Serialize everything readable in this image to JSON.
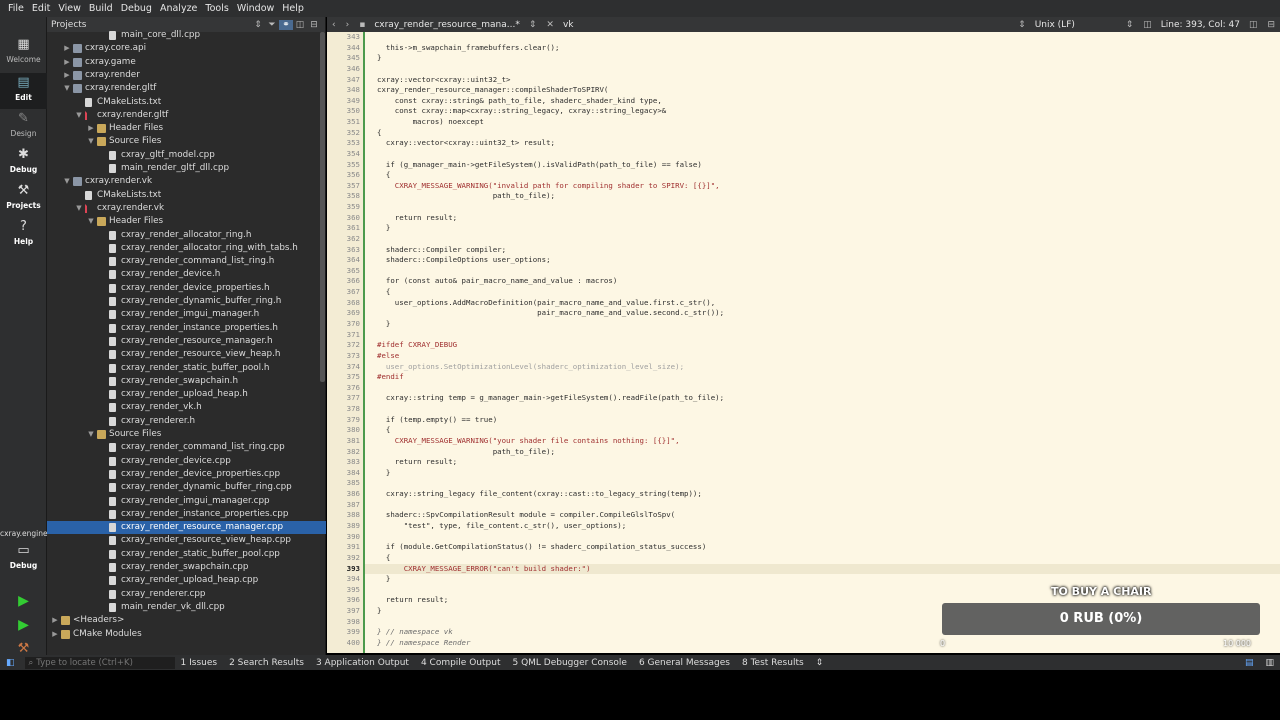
{
  "menu": [
    "File",
    "Edit",
    "View",
    "Build",
    "Debug",
    "Analyze",
    "Tools",
    "Window",
    "Help"
  ],
  "modes": [
    {
      "label": "Welcome",
      "icon": "grid-icon"
    },
    {
      "label": "Edit",
      "icon": "edit-icon"
    },
    {
      "label": "Design",
      "icon": "pen-icon"
    },
    {
      "label": "Debug",
      "icon": "bug-icon"
    },
    {
      "label": "Projects",
      "icon": "wrench-icon"
    },
    {
      "label": "Help",
      "icon": "help-icon"
    }
  ],
  "kit": {
    "name": "cxray.engine",
    "mode": "Debug"
  },
  "projects_panel": {
    "title": "Projects"
  },
  "tree": [
    {
      "label": "main_core_dll.cpp",
      "indent": 5,
      "icon": "file"
    },
    {
      "label": "cxray.core.api",
      "indent": 2,
      "icon": "proj",
      "arrow": "right"
    },
    {
      "label": "cxray.game",
      "indent": 2,
      "icon": "proj",
      "arrow": "right"
    },
    {
      "label": "cxray.render",
      "indent": 2,
      "icon": "proj",
      "arrow": "right"
    },
    {
      "label": "cxray.render.gltf",
      "indent": 2,
      "icon": "proj",
      "arrow": "down"
    },
    {
      "label": "CMakeLists.txt",
      "indent": 3,
      "icon": "file"
    },
    {
      "label": "cxray.render.gltf",
      "indent": 3,
      "icon": "cmake",
      "arrow": "down"
    },
    {
      "label": "Header Files",
      "indent": 4,
      "icon": "folder",
      "arrow": "right"
    },
    {
      "label": "Source Files",
      "indent": 4,
      "icon": "folder",
      "arrow": "down"
    },
    {
      "label": "cxray_gltf_model.cpp",
      "indent": 5,
      "icon": "file"
    },
    {
      "label": "main_render_gltf_dll.cpp",
      "indent": 5,
      "icon": "file"
    },
    {
      "label": "cxray.render.vk",
      "indent": 2,
      "icon": "proj",
      "arrow": "down"
    },
    {
      "label": "CMakeLists.txt",
      "indent": 3,
      "icon": "file"
    },
    {
      "label": "cxray.render.vk",
      "indent": 3,
      "icon": "cmake",
      "arrow": "down"
    },
    {
      "label": "Header Files",
      "indent": 4,
      "icon": "folder",
      "arrow": "down"
    },
    {
      "label": "cxray_render_allocator_ring.h",
      "indent": 5,
      "icon": "file"
    },
    {
      "label": "cxray_render_allocator_ring_with_tabs.h",
      "indent": 5,
      "icon": "file"
    },
    {
      "label": "cxray_render_command_list_ring.h",
      "indent": 5,
      "icon": "file"
    },
    {
      "label": "cxray_render_device.h",
      "indent": 5,
      "icon": "file"
    },
    {
      "label": "cxray_render_device_properties.h",
      "indent": 5,
      "icon": "file"
    },
    {
      "label": "cxray_render_dynamic_buffer_ring.h",
      "indent": 5,
      "icon": "file"
    },
    {
      "label": "cxray_render_imgui_manager.h",
      "indent": 5,
      "icon": "file"
    },
    {
      "label": "cxray_render_instance_properties.h",
      "indent": 5,
      "icon": "file"
    },
    {
      "label": "cxray_render_resource_manager.h",
      "indent": 5,
      "icon": "file"
    },
    {
      "label": "cxray_render_resource_view_heap.h",
      "indent": 5,
      "icon": "file"
    },
    {
      "label": "cxray_render_static_buffer_pool.h",
      "indent": 5,
      "icon": "file"
    },
    {
      "label": "cxray_render_swapchain.h",
      "indent": 5,
      "icon": "file"
    },
    {
      "label": "cxray_render_upload_heap.h",
      "indent": 5,
      "icon": "file"
    },
    {
      "label": "cxray_render_vk.h",
      "indent": 5,
      "icon": "file"
    },
    {
      "label": "cxray_renderer.h",
      "indent": 5,
      "icon": "file"
    },
    {
      "label": "Source Files",
      "indent": 4,
      "icon": "folder",
      "arrow": "down"
    },
    {
      "label": "cxray_render_command_list_ring.cpp",
      "indent": 5,
      "icon": "file"
    },
    {
      "label": "cxray_render_device.cpp",
      "indent": 5,
      "icon": "file"
    },
    {
      "label": "cxray_render_device_properties.cpp",
      "indent": 5,
      "icon": "file"
    },
    {
      "label": "cxray_render_dynamic_buffer_ring.cpp",
      "indent": 5,
      "icon": "file"
    },
    {
      "label": "cxray_render_imgui_manager.cpp",
      "indent": 5,
      "icon": "file"
    },
    {
      "label": "cxray_render_instance_properties.cpp",
      "indent": 5,
      "icon": "file"
    },
    {
      "label": "cxray_render_resource_manager.cpp",
      "indent": 5,
      "icon": "file",
      "selected": true
    },
    {
      "label": "cxray_render_resource_view_heap.cpp",
      "indent": 5,
      "icon": "file"
    },
    {
      "label": "cxray_render_static_buffer_pool.cpp",
      "indent": 5,
      "icon": "file"
    },
    {
      "label": "cxray_render_swapchain.cpp",
      "indent": 5,
      "icon": "file"
    },
    {
      "label": "cxray_render_upload_heap.cpp",
      "indent": 5,
      "icon": "file"
    },
    {
      "label": "cxray_renderer.cpp",
      "indent": 5,
      "icon": "file"
    },
    {
      "label": "main_render_vk_dll.cpp",
      "indent": 5,
      "icon": "file"
    },
    {
      "label": "<Headers>",
      "indent": 1,
      "icon": "folder",
      "arrow": "right"
    },
    {
      "label": "CMake Modules",
      "indent": 1,
      "icon": "folder",
      "arrow": "right"
    }
  ],
  "editor": {
    "filename": "cxray_render_resource_mana...*",
    "symbol": "vk",
    "line_ending": "Unix (LF)",
    "position": "Line: 393, Col: 47",
    "current_line": 393
  },
  "code": [
    {
      "n": 343,
      "t": ""
    },
    {
      "n": 344,
      "t": "  this->m_swapchain_framebuffers.clear();"
    },
    {
      "n": 345,
      "t": "}"
    },
    {
      "n": 346,
      "t": ""
    },
    {
      "n": 347,
      "t": "cxray::vector<cxray::uint32_t>"
    },
    {
      "n": 348,
      "t": "cxray_render_resource_manager::compileShaderToSPIRV("
    },
    {
      "n": 349,
      "t": "    const cxray::string& path_to_file, shaderc_shader_kind type,"
    },
    {
      "n": 350,
      "t": "    const cxray::map<cxray::string_legacy, cxray::string_legacy>&"
    },
    {
      "n": 351,
      "t": "        macros) noexcept"
    },
    {
      "n": 352,
      "t": "{"
    },
    {
      "n": 353,
      "t": "  cxray::vector<cxray::uint32_t> result;"
    },
    {
      "n": 354,
      "t": ""
    },
    {
      "n": 355,
      "t": "  if (g_manager_main->getFileSystem().isValidPath(path_to_file) == false)"
    },
    {
      "n": 356,
      "t": "  {"
    },
    {
      "n": 357,
      "t": "    CXRAY_MESSAGE_WARNING(\"invalid path for compiling shader to SPIRV: [{}]\","
    },
    {
      "n": 358,
      "t": "                          path_to_file);"
    },
    {
      "n": 359,
      "t": ""
    },
    {
      "n": 360,
      "t": "    return result;"
    },
    {
      "n": 361,
      "t": "  }"
    },
    {
      "n": 362,
      "t": ""
    },
    {
      "n": 363,
      "t": "  shaderc::Compiler compiler;"
    },
    {
      "n": 364,
      "t": "  shaderc::CompileOptions user_options;"
    },
    {
      "n": 365,
      "t": ""
    },
    {
      "n": 366,
      "t": "  for (const auto& pair_macro_name_and_value : macros)"
    },
    {
      "n": 367,
      "t": "  {"
    },
    {
      "n": 368,
      "t": "    user_options.AddMacroDefinition(pair_macro_name_and_value.first.c_str(),"
    },
    {
      "n": 369,
      "t": "                                    pair_macro_name_and_value.second.c_str());"
    },
    {
      "n": 370,
      "t": "  }"
    },
    {
      "n": 371,
      "t": ""
    },
    {
      "n": 372,
      "t": "#ifdef CXRAY_DEBUG"
    },
    {
      "n": 373,
      "t": "#else"
    },
    {
      "n": 374,
      "t": "  user_options.SetOptimizationLevel(shaderc_optimization_level_size);"
    },
    {
      "n": 375,
      "t": "#endif"
    },
    {
      "n": 376,
      "t": ""
    },
    {
      "n": 377,
      "t": "  cxray::string temp = g_manager_main->getFileSystem().readFile(path_to_file);"
    },
    {
      "n": 378,
      "t": ""
    },
    {
      "n": 379,
      "t": "  if (temp.empty() == true)"
    },
    {
      "n": 380,
      "t": "  {"
    },
    {
      "n": 381,
      "t": "    CXRAY_MESSAGE_WARNING(\"your shader file contains nothing: [{}]\","
    },
    {
      "n": 382,
      "t": "                          path_to_file);"
    },
    {
      "n": 383,
      "t": "    return result;"
    },
    {
      "n": 384,
      "t": "  }"
    },
    {
      "n": 385,
      "t": ""
    },
    {
      "n": 386,
      "t": "  cxray::string_legacy file_content(cxray::cast::to_legacy_string(temp));"
    },
    {
      "n": 387,
      "t": ""
    },
    {
      "n": 388,
      "t": "  shaderc::SpvCompilationResult module = compiler.CompileGlslToSpv("
    },
    {
      "n": 389,
      "t": "      \"test\", type, file_content.c_str(), user_options);"
    },
    {
      "n": 390,
      "t": ""
    },
    {
      "n": 391,
      "t": "  if (module.GetCompilationStatus() != shaderc_compilation_status_success)"
    },
    {
      "n": 392,
      "t": "  {"
    },
    {
      "n": 393,
      "t": "      CXRAY_MESSAGE_ERROR(\"can't build shader:\")"
    },
    {
      "n": 394,
      "t": "  }"
    },
    {
      "n": 395,
      "t": ""
    },
    {
      "n": 396,
      "t": "  return result;"
    },
    {
      "n": 397,
      "t": "}"
    },
    {
      "n": 398,
      "t": ""
    },
    {
      "n": 399,
      "t": "} // namespace vk"
    },
    {
      "n": 400,
      "t": "} // namespace Render"
    }
  ],
  "donation": {
    "title": "TO BUY A CHAIR",
    "value": "0 RUB (0%)",
    "progress_fraction": 0,
    "min": "0",
    "max": "10 000"
  },
  "statusbar": {
    "locator_placeholder": "Type to locate (Ctrl+K)",
    "panes": [
      "1  Issues",
      "2  Search Results",
      "3  Application Output",
      "4  Compile Output",
      "5  QML Debugger Console",
      "6  General Messages",
      "8  Test Results"
    ]
  }
}
